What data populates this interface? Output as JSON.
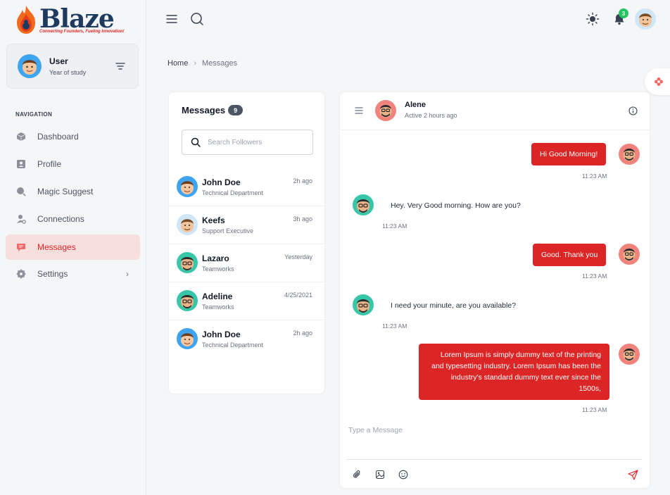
{
  "brand": {
    "name": "Blaze",
    "tagline": "Connecting Founders, Fueling Innovation!"
  },
  "user": {
    "name": "User",
    "subtitle": "Year of study"
  },
  "nav": {
    "heading": "NAVIGATION",
    "items": [
      {
        "label": "Dashboard",
        "icon": "cube-icon"
      },
      {
        "label": "Profile",
        "icon": "id-card-icon"
      },
      {
        "label": "Magic Suggest",
        "icon": "magic-icon"
      },
      {
        "label": "Connections",
        "icon": "connections-icon"
      },
      {
        "label": "Messages",
        "icon": "message-icon",
        "active": true
      },
      {
        "label": "Settings",
        "icon": "gear-icon"
      }
    ]
  },
  "header": {
    "notifications_count": "3"
  },
  "breadcrumb": {
    "home": "Home",
    "current": "Messages"
  },
  "messages_panel": {
    "title": "Messages",
    "count": "9",
    "search_placeholder": "Search Followers",
    "contacts": [
      {
        "name": "John Doe",
        "role": "Technical Department",
        "time": "2h ago"
      },
      {
        "name": "Keefs",
        "role": "Support Executive",
        "time": "3h ago"
      },
      {
        "name": "Lazaro",
        "role": "Teamworks",
        "time": "Yesterday"
      },
      {
        "name": "Adeline",
        "role": "Teamworks",
        "time": "4/25/2021"
      },
      {
        "name": "John Doe",
        "role": "Technical Department",
        "time": "2h ago"
      }
    ]
  },
  "chat": {
    "name": "Alene",
    "status": "Active 2 hours ago",
    "messages": [
      {
        "direction": "out",
        "text": "Hi Good Morning!",
        "time": "11:23 AM"
      },
      {
        "direction": "in",
        "text": "Hey. Very Good morning. How are you?",
        "time": "11:23 AM"
      },
      {
        "direction": "out",
        "text": "Good. Thank you",
        "time": "11:23 AM"
      },
      {
        "direction": "in",
        "text": "I need your minute, are you available?",
        "time": "11:23 AM"
      },
      {
        "direction": "out",
        "text": "Lorem Ipsum is simply dummy text of the printing and typesetting industry. Lorem Ipsum has been the industry's standard dummy text ever since the 1500s,",
        "time": "11:23 AM"
      }
    ],
    "input_placeholder": "Type a Message"
  },
  "colors": {
    "accent": "#dc2626",
    "active_nav_bg": "#f9dede",
    "badge_green": "#22c55e"
  }
}
